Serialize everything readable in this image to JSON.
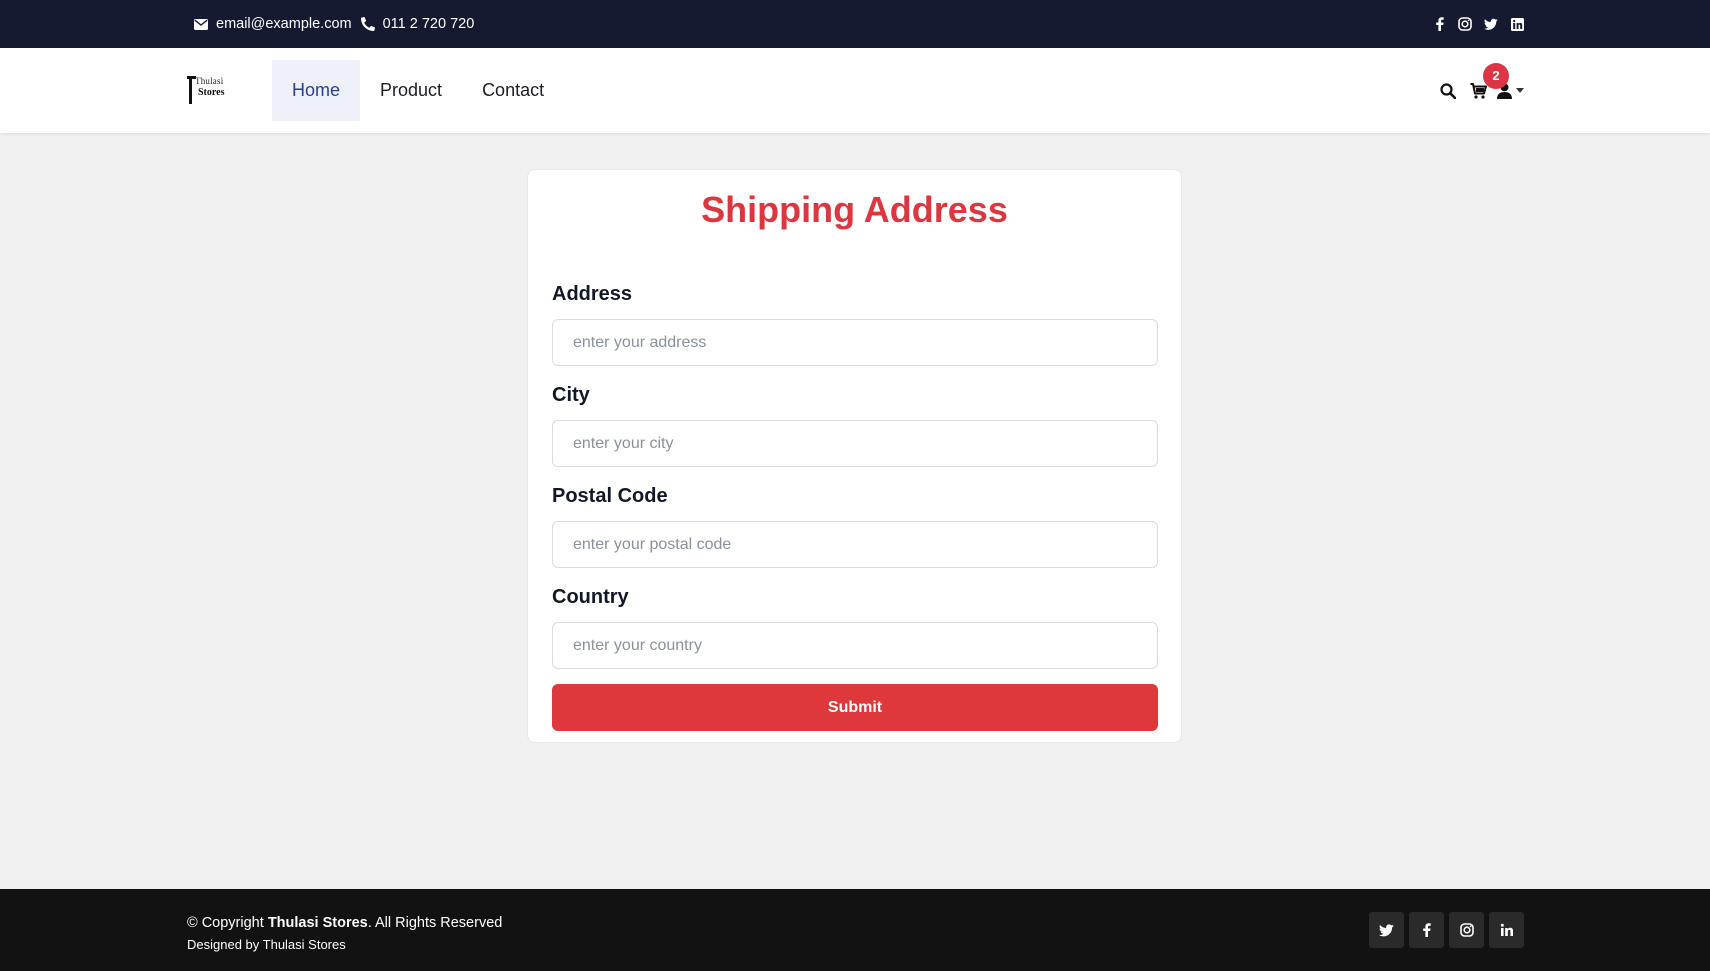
{
  "topbar": {
    "email": "email@example.com",
    "phone": "011 2 720 720",
    "social_icons": [
      "facebook-icon",
      "instagram-icon",
      "twitter-icon",
      "linkedin-icon"
    ]
  },
  "navbar": {
    "logo": {
      "line1": "Thulasi",
      "line2": "Stores"
    },
    "links": [
      {
        "label": "Home",
        "active": true
      },
      {
        "label": "Product",
        "active": false
      },
      {
        "label": "Contact",
        "active": false
      }
    ],
    "cart_count": "2",
    "icons": [
      "search-icon",
      "cart-icon",
      "user-icon",
      "caret-down-icon"
    ]
  },
  "form": {
    "title": "Shipping Address",
    "fields": [
      {
        "label": "Address",
        "placeholder": "enter your address",
        "value": ""
      },
      {
        "label": "City",
        "placeholder": "enter your city",
        "value": ""
      },
      {
        "label": "Postal Code",
        "placeholder": "enter your postal code",
        "value": ""
      },
      {
        "label": "Country",
        "placeholder": "enter your country",
        "value": ""
      }
    ],
    "submit_label": "Submit"
  },
  "footer": {
    "copyright_prefix": "© Copyright ",
    "brand": "Thulasi Stores",
    "copyright_suffix": ". All Rights Reserved",
    "designed_by": "Designed by Thulasi Stores",
    "social_icons": [
      "twitter-icon",
      "facebook-icon",
      "instagram-icon",
      "linkedin-icon"
    ]
  },
  "colors": {
    "topbar_bg": "#151a30",
    "accent_red": "#dc3545",
    "active_nav_text": "#2b3e8a",
    "footer_bg": "#121212",
    "page_bg": "#f0f0f0"
  }
}
